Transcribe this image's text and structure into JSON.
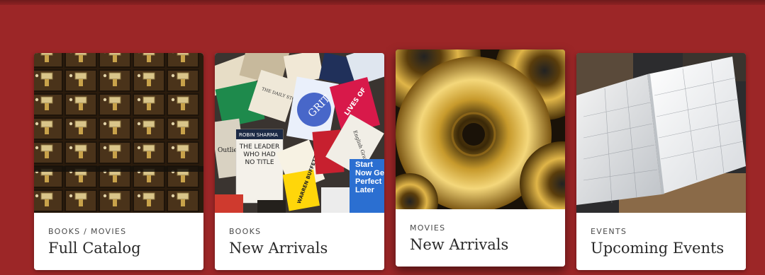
{
  "cards": [
    {
      "category": "BOOKS / MOVIES",
      "title": "Full Catalog",
      "image": "card-catalog-drawers"
    },
    {
      "category": "BOOKS",
      "title": "New Arrivals",
      "image": "pile-of-books"
    },
    {
      "category": "MOVIES",
      "title": "New Arrivals",
      "image": "golden-discs"
    },
    {
      "category": "EVENTS",
      "title": "Upcoming Events",
      "image": "open-planner"
    }
  ],
  "book_covers": {
    "cover1": "ROBIN SHARMA",
    "cover1b": "THE LEADER WHO HAD NO TITLE",
    "cover2": "THE DAILY STOIC",
    "cover3": "GRIT",
    "cover4": "WARREN BUFFETT WAY",
    "cover5": "Start Now Get Perfect Later",
    "cover6": "LIVES OF",
    "cover7": "Outliers",
    "cover8": "English Grammar"
  },
  "colors": {
    "background": "#9c2627",
    "card": "#ffffff",
    "category_text": "#4a4a4a",
    "title_text": "#2a2a2a"
  }
}
